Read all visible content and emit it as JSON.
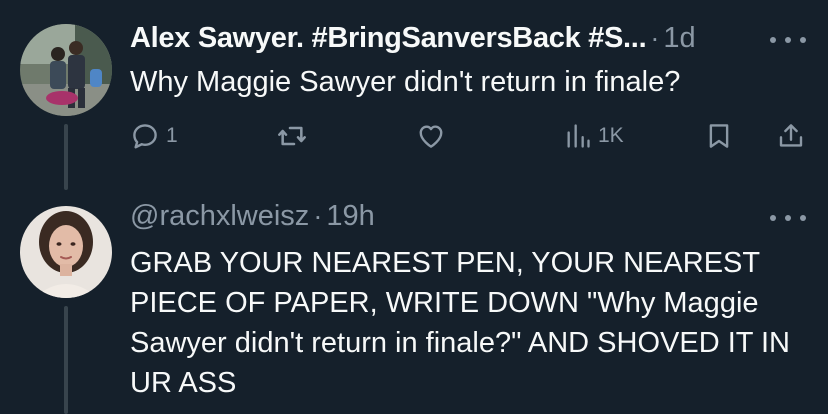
{
  "tweet1": {
    "display_name": "Alex Sawyer. #BringSanversBack #S...",
    "separator": "·",
    "time": "1d",
    "text": "Why Maggie Sawyer didn't return in finale?",
    "reply_count": "1",
    "view_count": "1K"
  },
  "tweet2": {
    "handle": "@rachxlweisz",
    "separator": "·",
    "time": "19h",
    "text": "GRAB YOUR NEAREST PEN, YOUR NEAREST PIECE OF PAPER, WRITE DOWN \"Why Maggie Sawyer didn't return in finale?\" AND SHOVED IT IN UR ASS"
  },
  "icons": [
    "reply-icon",
    "retweet-icon",
    "like-icon",
    "views-icon",
    "bookmark-icon",
    "share-icon",
    "more-icon"
  ],
  "colors": {
    "background": "#15202b",
    "primary_text": "#f7f9f9",
    "secondary_text": "#8b98a5",
    "thread_line": "#38444d"
  }
}
